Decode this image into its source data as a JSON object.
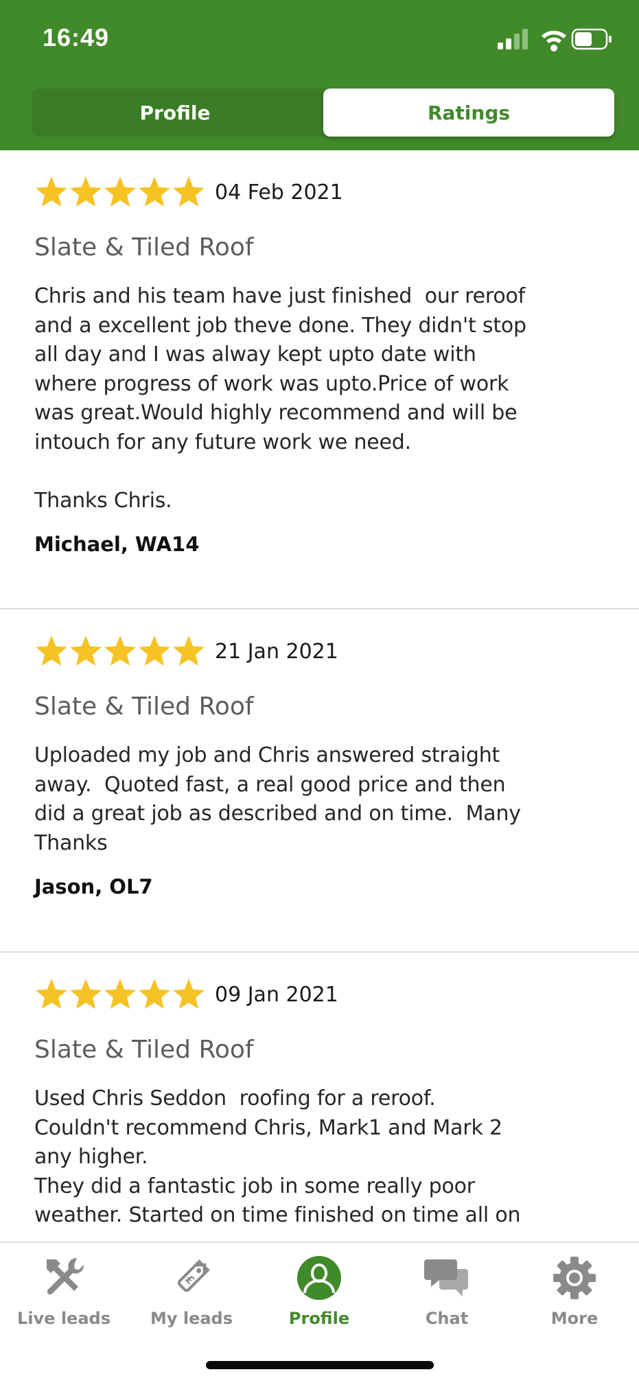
{
  "status_bar": {
    "time": "16:49"
  },
  "segmented": {
    "profile_label": "Profile",
    "ratings_label": "Ratings",
    "selected": "Ratings"
  },
  "colors": {
    "brand_green": "#418a2a",
    "star_gold": "#f6c325",
    "inactive_gray": "#8a8a8a"
  },
  "reviews": [
    {
      "stars": 5,
      "date": "04 Feb 2021",
      "category": "Slate & Tiled Roof",
      "body": "Chris and his team have just finished  our reroof\nand a excellent job theve done. They didn't stop\nall day and I was alway kept upto date with\nwhere progress of work was upto.Price of work\nwas great.Would highly recommend and will be\nintouch for any future work we need.\n\nThanks Chris.",
      "author": "Michael, WA14"
    },
    {
      "stars": 5,
      "date": "21 Jan 2021",
      "category": "Slate & Tiled Roof",
      "body": "Uploaded my job and Chris answered straight\naway.  Quoted fast, a real good price and then\ndid a great job as described and on time.  Many\nThanks",
      "author": "Jason, OL7"
    },
    {
      "stars": 5,
      "date": "09 Jan 2021",
      "category": "Slate & Tiled Roof",
      "body": "Used Chris Seddon  roofing for a reroof.\nCouldn't recommend Chris, Mark1 and Mark 2\nany higher.\nThey did a fantastic job in some really poor\nweather. Started on time finished on time all on",
      "author": ""
    }
  ],
  "tabs": [
    {
      "label": "Live leads",
      "icon": "hammer-wrench-icon",
      "active": false
    },
    {
      "label": "My leads",
      "icon": "price-tag-icon",
      "active": false
    },
    {
      "label": "Profile",
      "icon": "user-profile-icon",
      "active": true
    },
    {
      "label": "Chat",
      "icon": "chat-bubbles-icon",
      "active": false
    },
    {
      "label": "More",
      "icon": "gear-icon",
      "active": false
    }
  ]
}
